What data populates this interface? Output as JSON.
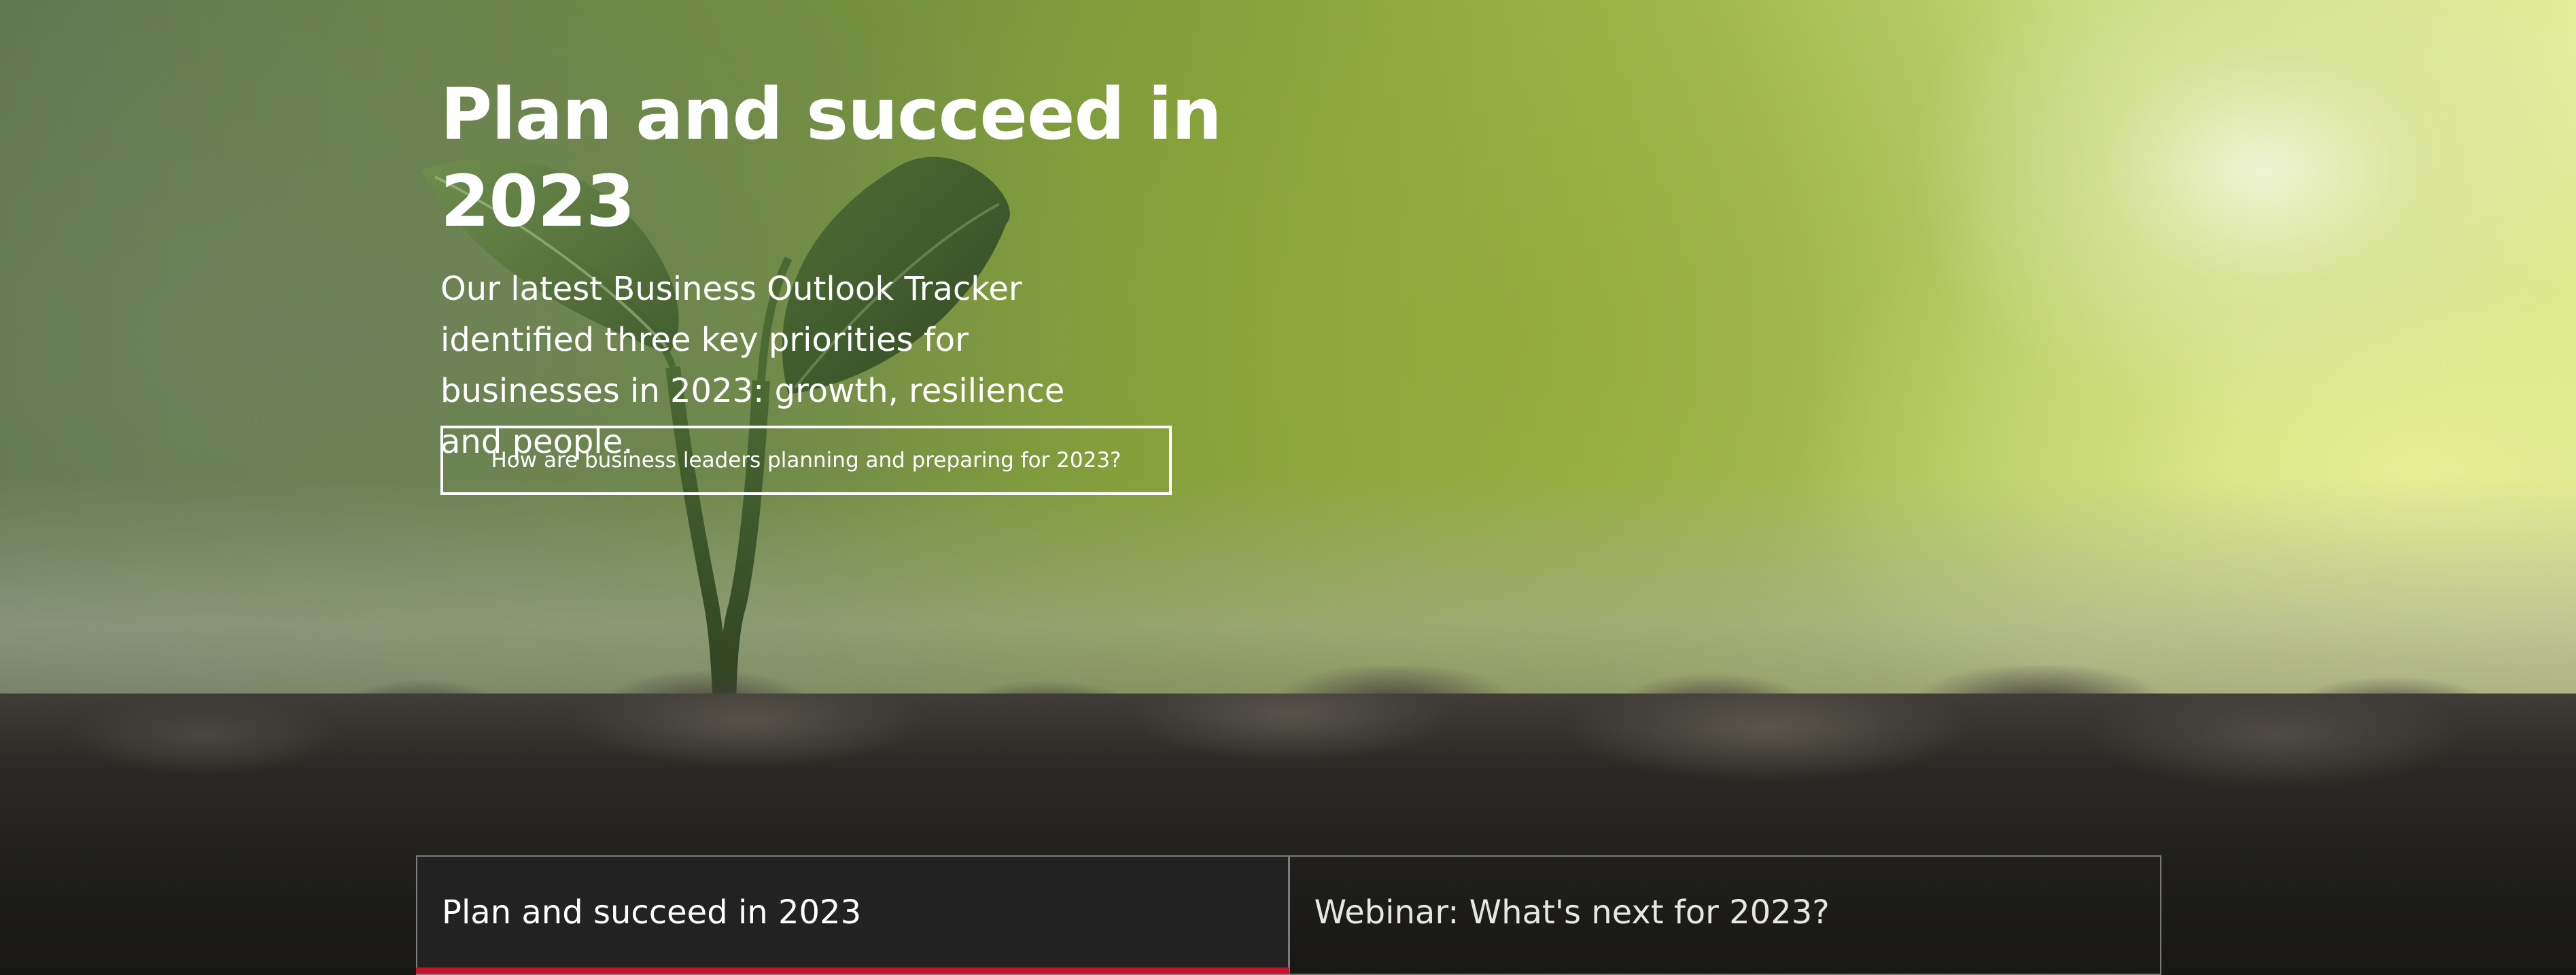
{
  "hero": {
    "title": "Plan and succeed in 2023",
    "subtitle": "Our latest Business Outlook Tracker identified three key priorities for businesses in 2023: growth, resilience and people.",
    "cta_label": "How are business leaders planning and preparing for 2023?",
    "background_image": "seedling-in-soil"
  },
  "tabs": [
    {
      "label": "Plan and succeed in 2023",
      "active": true
    },
    {
      "label": "Webinar: What's next for 2023?",
      "active": false
    }
  ],
  "colors": {
    "text": "#ffffff",
    "active_tab_bg": "#222222",
    "accent": "#c8102e"
  }
}
